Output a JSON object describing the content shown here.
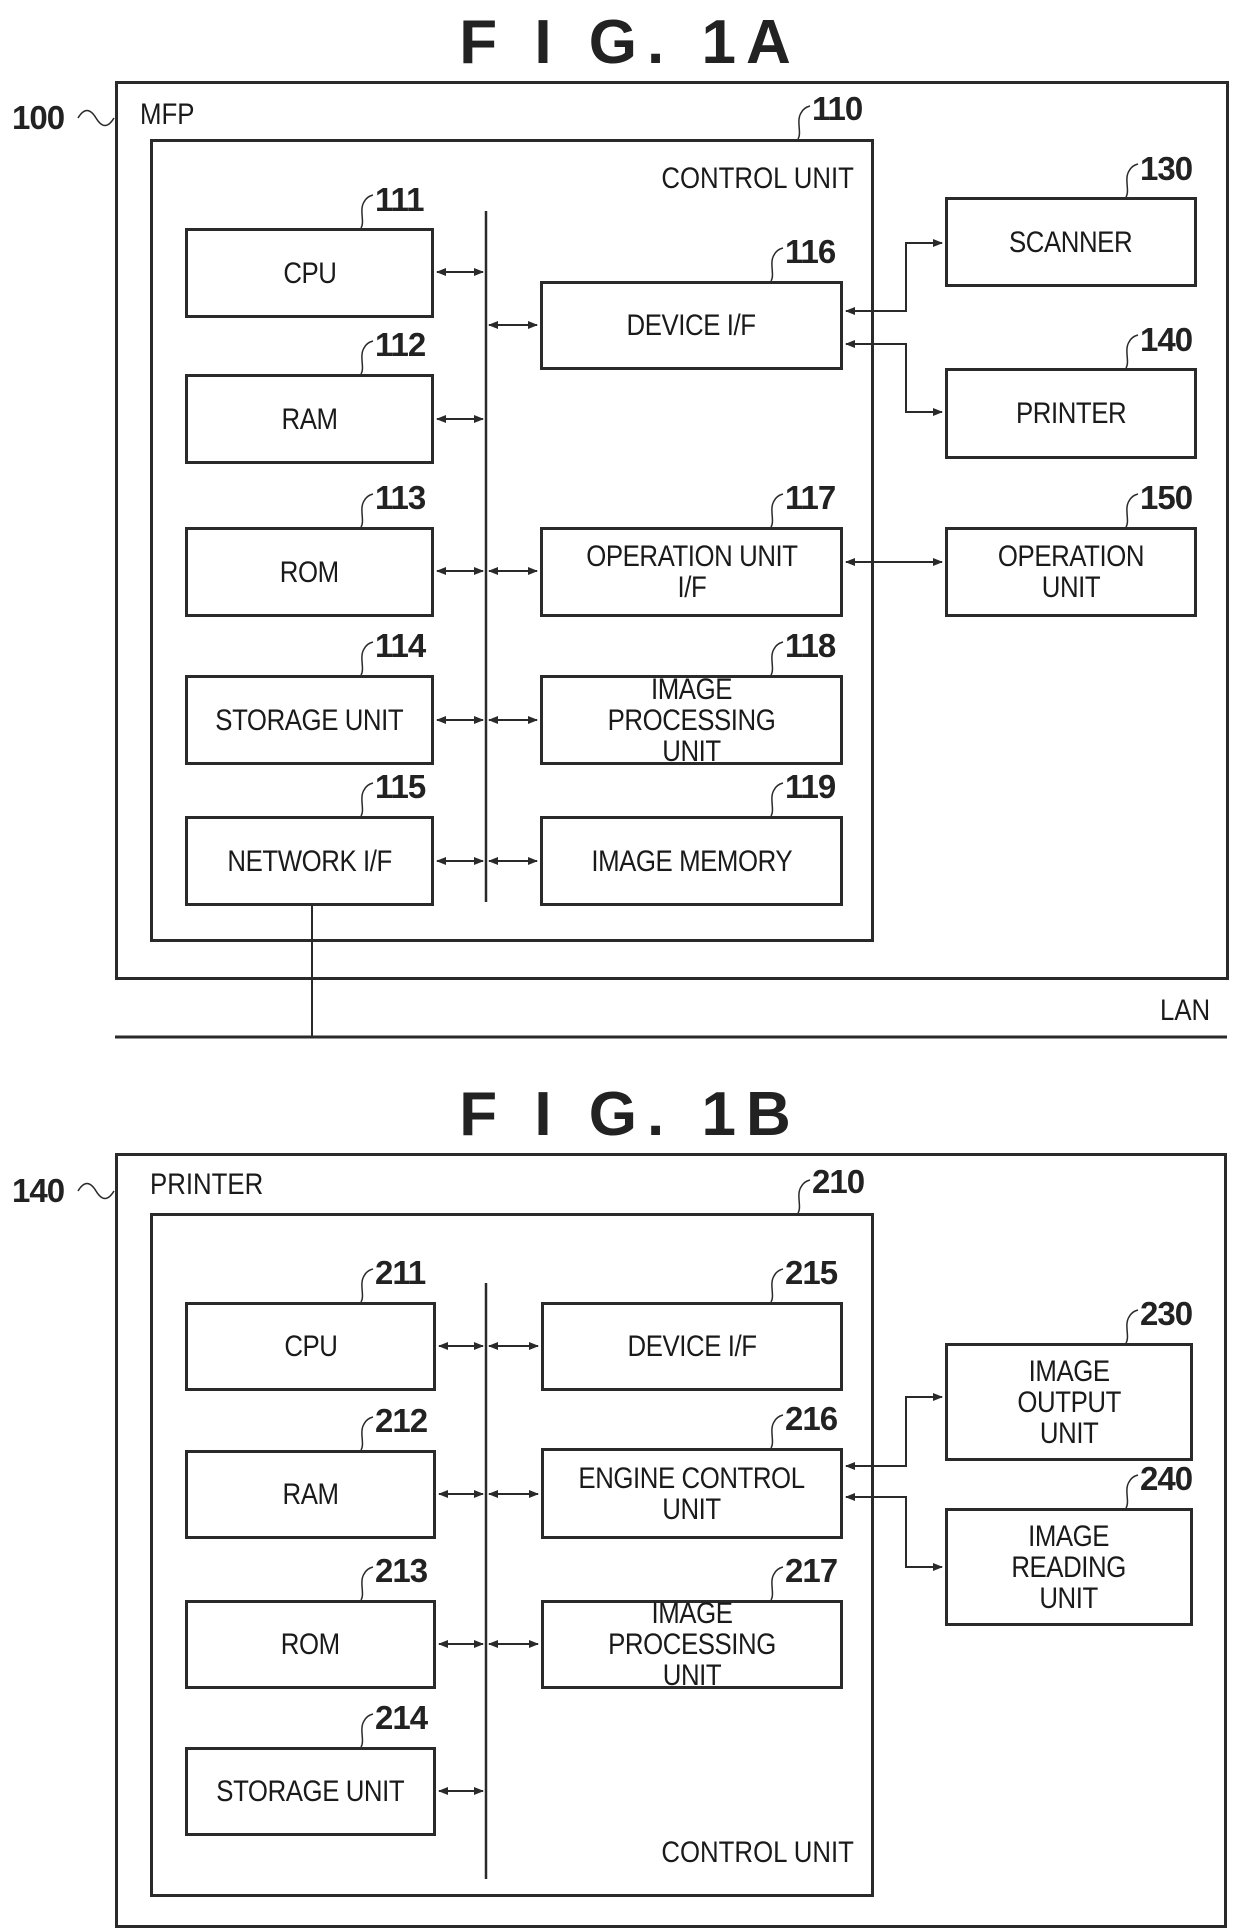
{
  "figure_a": {
    "title": "F I G.  1A",
    "outer": {
      "ref": "100",
      "label": "MFP"
    },
    "control_unit": {
      "ref": "110",
      "label": "CONTROL UNIT"
    },
    "left_blocks": [
      {
        "ref": "111",
        "label": "CPU"
      },
      {
        "ref": "112",
        "label": "RAM"
      },
      {
        "ref": "113",
        "label": "ROM"
      },
      {
        "ref": "114",
        "label": "STORAGE UNIT"
      },
      {
        "ref": "115",
        "label": "NETWORK I/F"
      }
    ],
    "right_blocks": [
      {
        "ref": "116",
        "label": "DEVICE I/F"
      },
      {
        "ref": "117",
        "label": "OPERATION UNIT\nI/F"
      },
      {
        "ref": "118",
        "label": "IMAGE PROCESSING\nUNIT"
      },
      {
        "ref": "119",
        "label": "IMAGE MEMORY"
      }
    ],
    "external_blocks": [
      {
        "ref": "130",
        "label": "SCANNER"
      },
      {
        "ref": "140",
        "label": "PRINTER"
      },
      {
        "ref": "150",
        "label": "OPERATION\nUNIT"
      }
    ],
    "network_label": "LAN"
  },
  "figure_b": {
    "title": "F I G.  1B",
    "outer": {
      "ref": "140",
      "label": "PRINTER"
    },
    "control_unit": {
      "ref": "210",
      "label": "CONTROL UNIT"
    },
    "left_blocks": [
      {
        "ref": "211",
        "label": "CPU"
      },
      {
        "ref": "212",
        "label": "RAM"
      },
      {
        "ref": "213",
        "label": "ROM"
      },
      {
        "ref": "214",
        "label": "STORAGE UNIT"
      }
    ],
    "right_blocks": [
      {
        "ref": "215",
        "label": "DEVICE I/F"
      },
      {
        "ref": "216",
        "label": "ENGINE CONTROL\nUNIT"
      },
      {
        "ref": "217",
        "label": "IMAGE PROCESSING\nUNIT"
      }
    ],
    "external_blocks": [
      {
        "ref": "230",
        "label": "IMAGE\nOUTPUT\nUNIT"
      },
      {
        "ref": "240",
        "label": "IMAGE\nREADING\nUNIT"
      }
    ]
  }
}
